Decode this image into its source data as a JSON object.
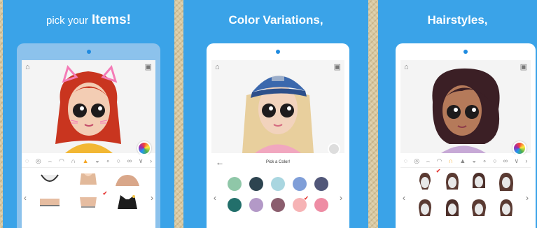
{
  "panels": [
    {
      "caption_light": "pick your",
      "caption_bold": "Items!",
      "categories": [
        "&#x25CC;",
        "&#x25CE;",
        "&#x2322;",
        "&#x25E0;",
        "&#x2229;",
        "&#x25B2;",
        "&#x25D2;",
        "&#x2218;",
        "&#x25CB;",
        "&#x221E;",
        "&#x2228;",
        "&#x203A;"
      ],
      "items": [
        "bikini-top",
        "crop-top",
        "shoulder-top",
        "bandeau",
        "tube-top",
        "jacket-dark"
      ]
    },
    {
      "caption": "Color Variations,",
      "color_picker_title": "Pick a Color!",
      "swatches": [
        "#8fc7a8",
        "#2d4450",
        "#a9d6e0",
        "#7f9ed8",
        "#515779",
        "#226f6b",
        "#b399c7",
        "#8b5e6e",
        "#f6b3b5",
        "#ee8ca4"
      ]
    },
    {
      "caption": "Hairstyles,",
      "categories": [
        "&#x25CC;",
        "&#x25CE;",
        "&#x2322;",
        "&#x25E0;",
        "&#x2229;",
        "&#x25B2;",
        "&#x25D2;",
        "&#x2218;",
        "&#x25CB;",
        "&#x221E;",
        "&#x2228;",
        "&#x203A;"
      ]
    }
  ],
  "icons": {
    "home": "home-icon",
    "save": "save-icon",
    "back": "back-arrow-icon"
  },
  "colors": {
    "panel_bg": "#3aa3e8",
    "accent": "#f5a623",
    "check": "#e53935"
  }
}
